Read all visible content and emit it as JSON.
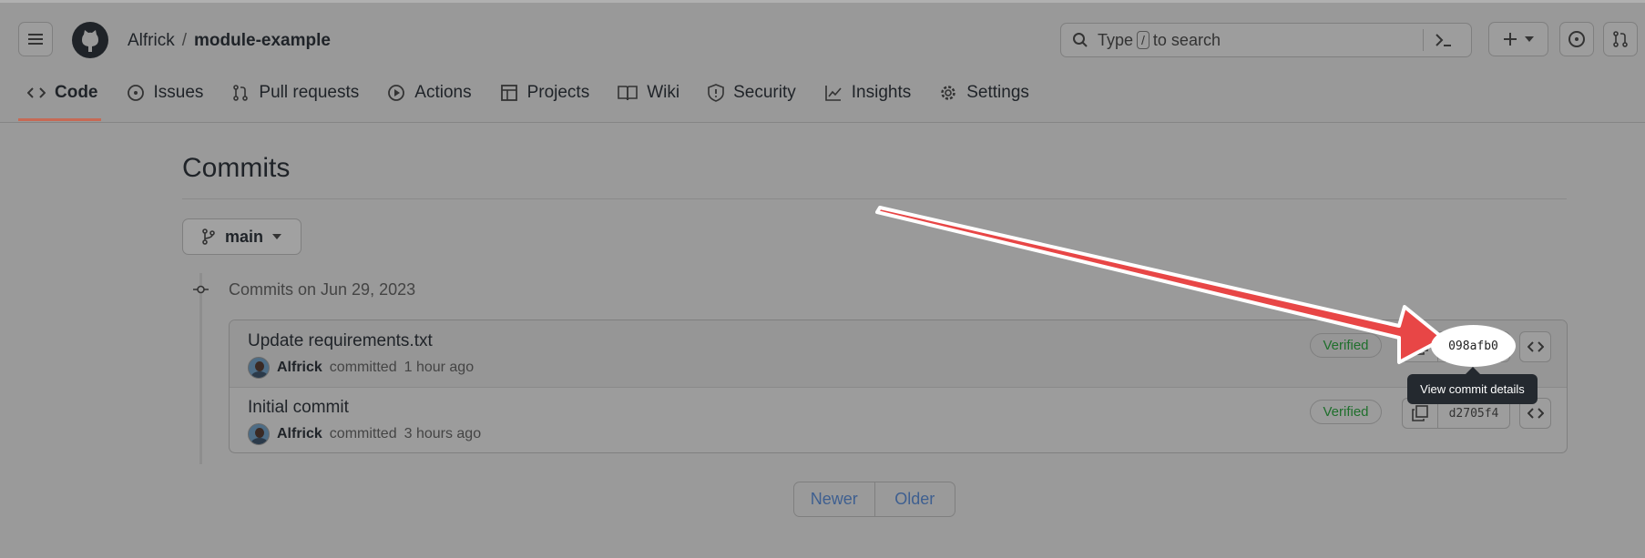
{
  "header": {
    "owner": "Alfrick",
    "separator": "/",
    "repo": "module-example",
    "search_prefix": "Type",
    "search_key": "/",
    "search_suffix": "to search",
    "icons": [
      "hamburger-icon",
      "github-logo",
      "search-icon",
      "terminal-icon",
      "plus-icon",
      "chevron-down-icon",
      "issues-icon",
      "pull-request-icon"
    ]
  },
  "nav": {
    "items": [
      {
        "label": "Code",
        "icon": "code-icon",
        "active": true
      },
      {
        "label": "Issues",
        "icon": "issue-opened-icon"
      },
      {
        "label": "Pull requests",
        "icon": "git-pull-request-icon"
      },
      {
        "label": "Actions",
        "icon": "play-icon"
      },
      {
        "label": "Projects",
        "icon": "table-icon"
      },
      {
        "label": "Wiki",
        "icon": "book-icon"
      },
      {
        "label": "Security",
        "icon": "shield-icon"
      },
      {
        "label": "Insights",
        "icon": "graph-icon"
      },
      {
        "label": "Settings",
        "icon": "gear-icon"
      }
    ]
  },
  "page": {
    "title": "Commits",
    "branch": "main",
    "date_heading": "Commits on Jun 29, 2023"
  },
  "commits": [
    {
      "message": "Update requirements.txt",
      "author": "Alfrick",
      "action": "committed",
      "time": "1 hour ago",
      "badge": "Verified",
      "sha": "098afb0"
    },
    {
      "message": "Initial commit",
      "author": "Alfrick",
      "action": "committed",
      "time": "3 hours ago",
      "badge": "Verified",
      "sha": "d2705f4"
    }
  ],
  "tooltip": "View commit details",
  "pager": {
    "newer": "Newer",
    "older": "Older"
  },
  "colors": {
    "overlay": "#9a9a9a",
    "annotation_arrow": "#e84646",
    "verified": "#1f6f2c",
    "tooltip_bg": "#24292f"
  }
}
